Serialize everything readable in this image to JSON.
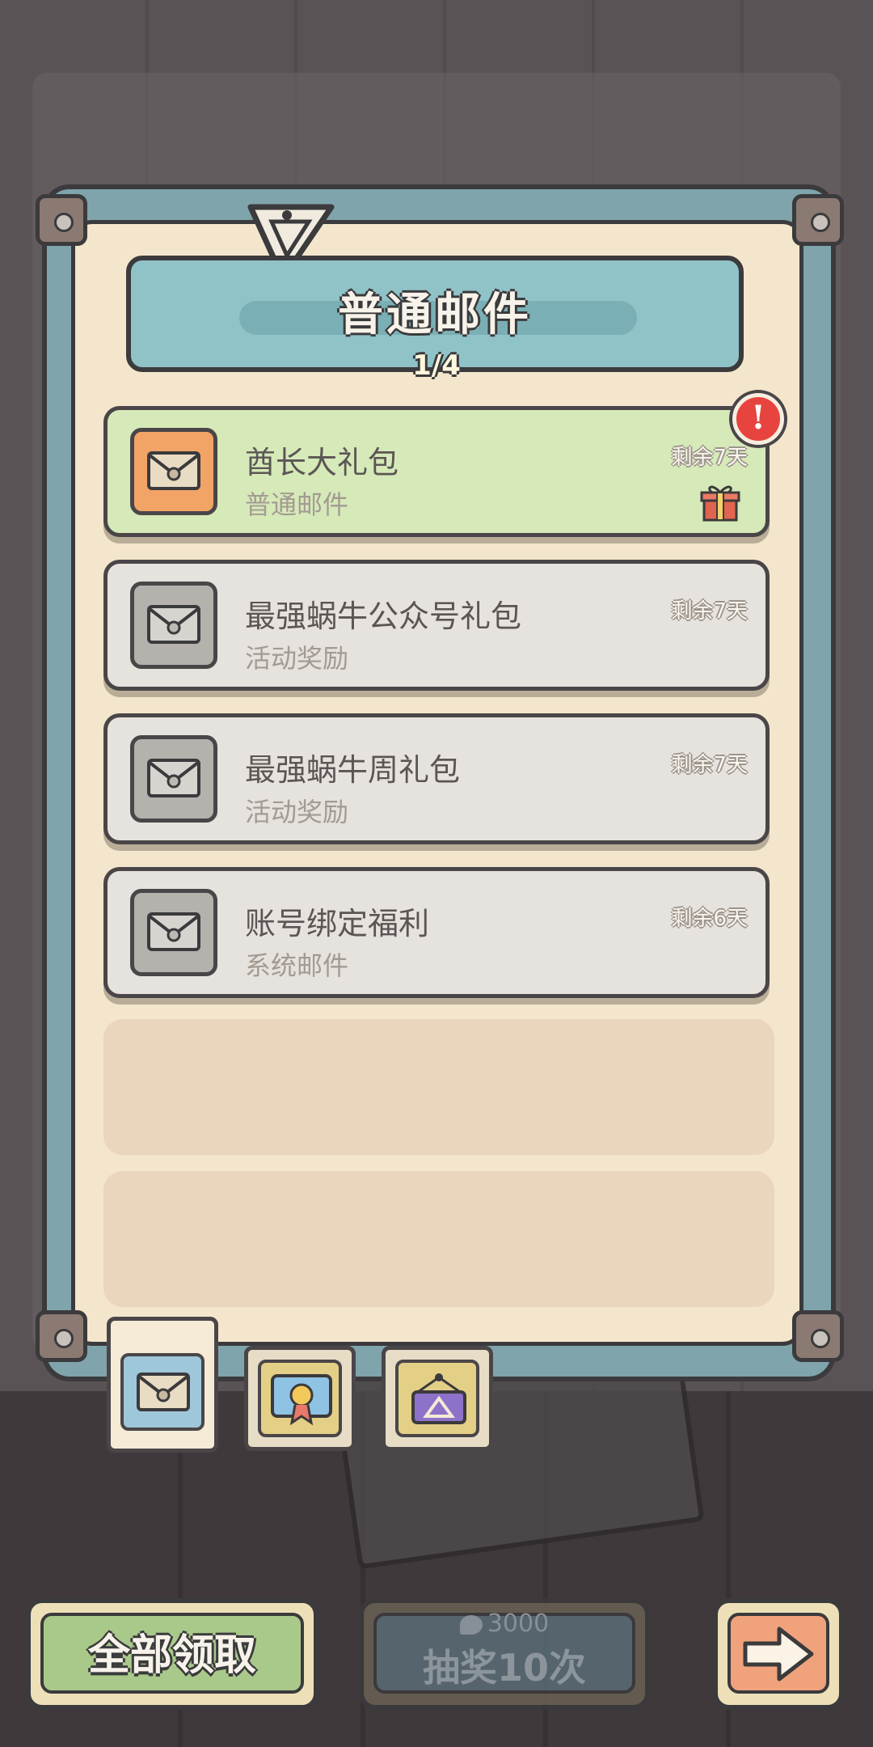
{
  "header": {
    "title": "普通邮件",
    "page_indicator": "1/4"
  },
  "mails": [
    {
      "title": "酋长大礼包",
      "subtitle": "普通邮件",
      "remaining": "剩余7天",
      "state": "unread-with-attachment"
    },
    {
      "title": "最强蜗牛公众号礼包",
      "subtitle": "活动奖励",
      "remaining": "剩余7天",
      "state": "read"
    },
    {
      "title": "最强蜗牛周礼包",
      "subtitle": "活动奖励",
      "remaining": "剩余7天",
      "state": "read"
    },
    {
      "title": "账号绑定福利",
      "subtitle": "系统邮件",
      "remaining": "剩余6天",
      "state": "read"
    }
  ],
  "alert_badge": "!",
  "tabs": [
    {
      "icon": "envelope-icon",
      "selected": true
    },
    {
      "icon": "award-certificate-icon",
      "selected": false
    },
    {
      "icon": "triangle-sign-icon",
      "selected": false
    }
  ],
  "buttons": {
    "claim_all": "全部领取",
    "draw_cost": "3000",
    "draw_label": "抽奖10次",
    "next_icon": "arrow-right-icon"
  },
  "colors": {
    "panel": "#f4e6cc",
    "frame": "#7fa4ac",
    "active_mail": "#d6e9b8",
    "read_mail": "#e6e2dd",
    "claim_button": "#a9c98a",
    "next_button": "#f0a27c",
    "alert": "#e8443f"
  }
}
